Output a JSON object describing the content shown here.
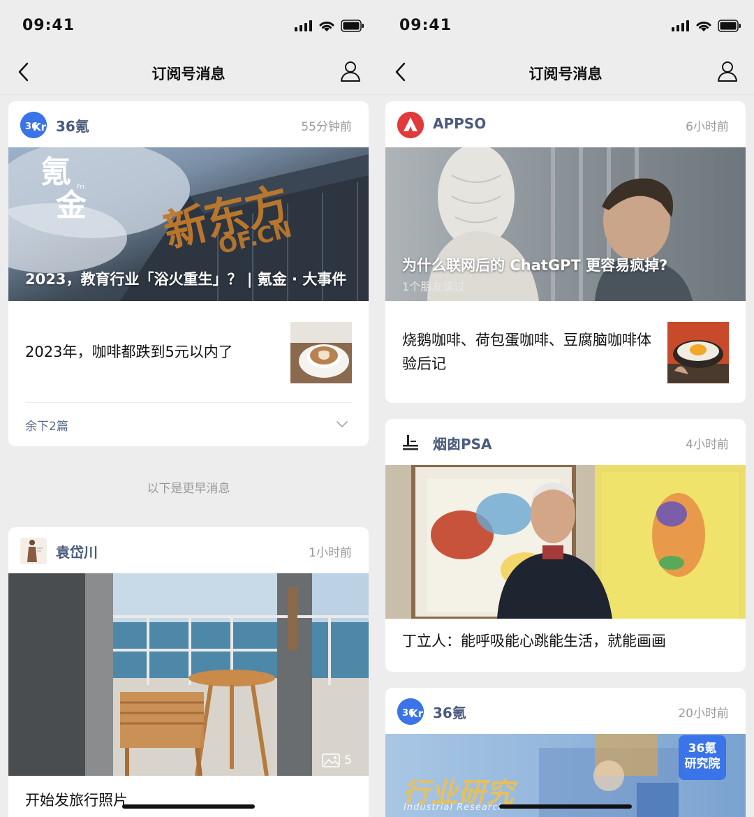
{
  "left": {
    "status_time": "09:41",
    "nav_title": "订阅号消息",
    "card1": {
      "account": "36氪",
      "ago": "55分钟前",
      "hero_title": "2023，教育行业「浴火重生」？ | 氪金 · 大事件",
      "logo_text_1": "氪",
      "logo_text_2": "金",
      "logo_small": "Fri.",
      "sign_text": "新东方",
      "sign_sub": "OF.CN",
      "row_title": "2023年，咖啡都跌到5元以内了",
      "more_label": "余下2篇"
    },
    "earlier_label": "以下是更早消息",
    "card2": {
      "account": "袁岱川",
      "ago": "1小时前",
      "photo_count": "5",
      "title": "开始发旅行照片"
    }
  },
  "right": {
    "status_time": "09:41",
    "nav_title": "订阅号消息",
    "card1": {
      "account": "APPSO",
      "ago": "6小时前",
      "hero_title": "为什么联网后的 ChatGPT 更容易疯掉?",
      "hero_sub": "1个朋友读过",
      "row_title": "烧鹅咖啡、荷包蛋咖啡、豆腐脑咖啡体验后记"
    },
    "card2": {
      "account": "烟囱PSA",
      "ago": "4小时前",
      "title": "丁立人：能呼吸能心跳能生活，就能画画"
    },
    "card3": {
      "account": "36氪",
      "ago": "20小时前",
      "badge_line1": "36氪",
      "badge_line2": "研究院",
      "hero_text": "行业研究",
      "hero_sub": "Industrial Research"
    }
  },
  "colors": {
    "accent_36kr": "#3a74e8",
    "accent_appso": "#e03a3a",
    "account_name": "#4a5a7c"
  },
  "icons": [
    "back-chevron-icon",
    "profile-icon",
    "signal-icon",
    "wifi-icon",
    "battery-icon",
    "chevron-down-icon",
    "image-icon",
    "chimney-icon"
  ]
}
